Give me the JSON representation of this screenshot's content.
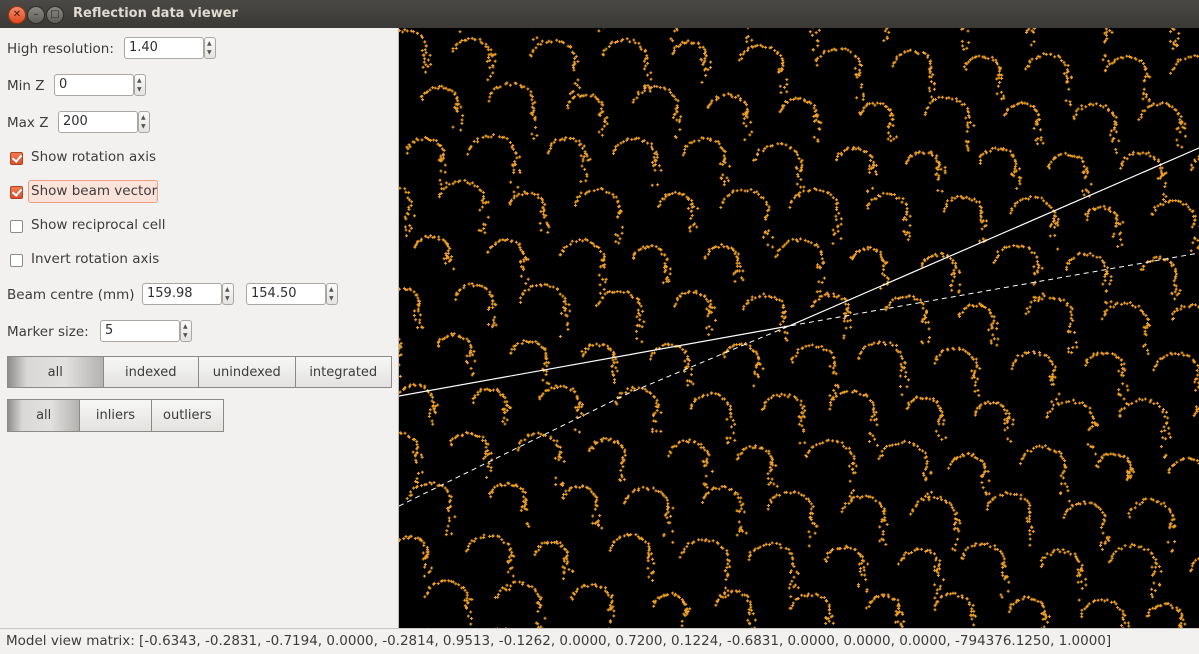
{
  "window": {
    "title": "Reflection data viewer"
  },
  "controls": {
    "high_resolution": {
      "label": "High resolution:",
      "value": "1.40"
    },
    "min_z": {
      "label": "Min Z",
      "value": "0"
    },
    "max_z": {
      "label": "Max Z",
      "value": "200"
    },
    "show_rotation_axis": {
      "label": "Show rotation axis",
      "checked": true
    },
    "show_beam_vector": {
      "label": "Show beam vector",
      "checked": true
    },
    "show_reciprocal_cell": {
      "label": "Show reciprocal cell",
      "checked": false
    },
    "invert_rotation_axis": {
      "label": "Invert rotation axis",
      "checked": false
    },
    "beam_centre": {
      "label": "Beam centre (mm)",
      "x": "159.98",
      "y": "154.50"
    },
    "marker_size": {
      "label": "Marker size:",
      "value": "5"
    }
  },
  "filter_reflections": {
    "options": [
      "all",
      "indexed",
      "unindexed",
      "integrated"
    ],
    "selected": "all"
  },
  "filter_outliers": {
    "options": [
      "all",
      "inliers",
      "outliers"
    ],
    "selected": "all"
  },
  "status": {
    "model_view_matrix": "Model view matrix: [-0.6343, -0.2831, -0.7194, 0.0000, -0.2814, 0.9513, -0.1262, 0.0000, 0.7200, 0.1224, -0.6831, 0.0000, 0.0000, 0.0000, -794376.1250, 1.0000]"
  },
  "colors": {
    "spot": "#f0a020",
    "background": "#000000",
    "axis_line": "#ffffff",
    "accent": "#e2582b"
  }
}
